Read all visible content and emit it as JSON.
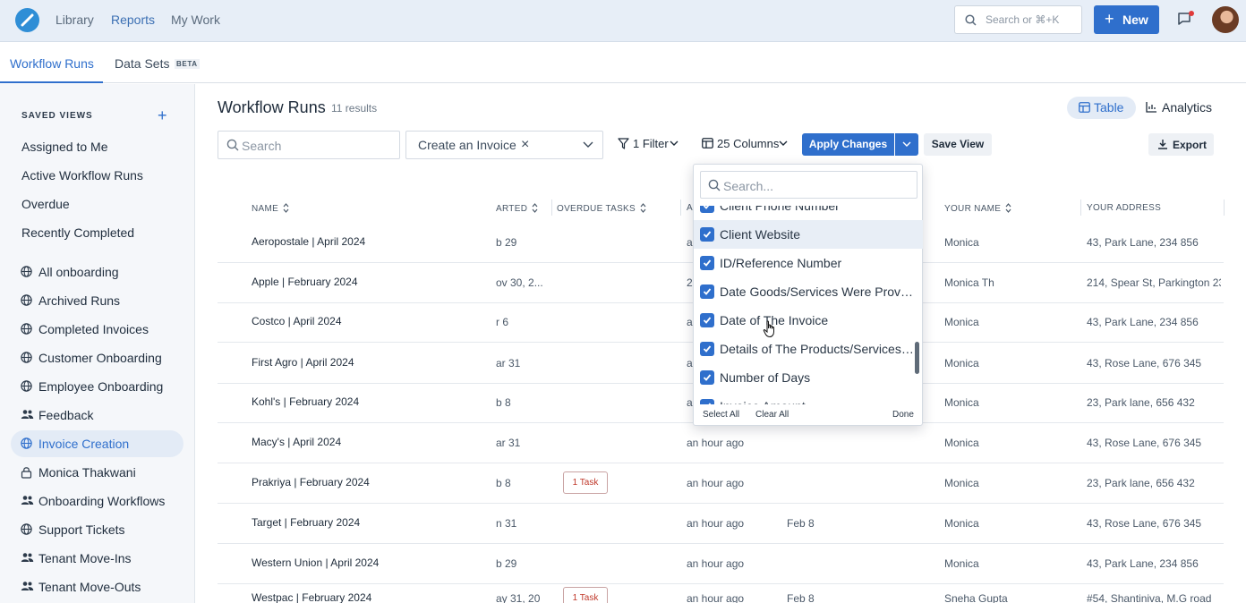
{
  "topbar": {
    "nav": [
      "Library",
      "Reports",
      "My Work"
    ],
    "active_nav": "Reports",
    "search_placeholder": "Search or ⌘+K",
    "new_label": "New",
    "brand_color": "#2f6fcc"
  },
  "subtabs": {
    "workflow_runs": "Workflow Runs",
    "data_sets": "Data Sets",
    "beta": "BETA"
  },
  "sidebar": {
    "saved_views_title": "SAVED VIEWS",
    "plain_items": [
      "Assigned to Me",
      "Active Workflow Runs",
      "Overdue",
      "Recently Completed"
    ],
    "items": [
      {
        "label": "All onboarding",
        "icon": "globe-icon"
      },
      {
        "label": "Archived Runs",
        "icon": "globe-icon"
      },
      {
        "label": "Completed Invoices",
        "icon": "globe-icon"
      },
      {
        "label": "Customer Onboarding",
        "icon": "globe-icon"
      },
      {
        "label": "Employee Onboarding",
        "icon": "globe-icon"
      },
      {
        "label": "Feedback",
        "icon": "users-icon"
      },
      {
        "label": "Invoice Creation",
        "icon": "globe-icon"
      },
      {
        "label": "Monica Thakwani",
        "icon": "lock-icon"
      },
      {
        "label": "Onboarding Workflows",
        "icon": "users-icon"
      },
      {
        "label": "Support Tickets",
        "icon": "globe-icon"
      },
      {
        "label": "Tenant Move-Ins",
        "icon": "users-icon"
      },
      {
        "label": "Tenant Move-Outs",
        "icon": "users-icon"
      }
    ],
    "active_item": "Invoice Creation"
  },
  "main": {
    "title": "Workflow Runs",
    "results": "11 results",
    "view_table": "Table",
    "view_analytics": "Analytics",
    "search_placeholder": "Search",
    "workflow_chip": "Create an Invoice",
    "filter_label": "1 Filter",
    "columns_label": "25 Columns",
    "apply_label": "Apply Changes",
    "save_view_label": "Save View",
    "export_label": "Export"
  },
  "table": {
    "headers": {
      "name": "NAME",
      "started": "ARTED",
      "overdue": "OVERDUE TASKS",
      "fourth": "A",
      "your_name": "YOUR NAME",
      "your_address": "YOUR ADDRESS"
    },
    "rows": [
      {
        "name": "Aeropostale | April 2024",
        "started": "b 29",
        "overdue": "",
        "col4": "a",
        "col5": "",
        "your_name": "Monica",
        "your_address": "43, Park Lane, 234 856"
      },
      {
        "name": "Apple | February 2024",
        "started": "ov 30, 2...",
        "overdue": "",
        "col4": "2",
        "col5": "",
        "your_name": "Monica Th",
        "your_address": "214, Spear St, Parkington 23"
      },
      {
        "name": "Costco | April 2024",
        "started": "r 6",
        "overdue": "",
        "col4": "a",
        "col5": "",
        "your_name": "Monica",
        "your_address": "43, Park Lane, 234 856"
      },
      {
        "name": "First Agro | April 2024",
        "started": "ar 31",
        "overdue": "",
        "col4": "a",
        "col5": "",
        "your_name": "Monica",
        "your_address": "43, Rose Lane, 676 345"
      },
      {
        "name": "Kohl's | February 2024",
        "started": "b 8",
        "overdue": "",
        "col4": "a",
        "col5": "",
        "your_name": "Monica",
        "your_address": "23, Park lane, 656 432"
      },
      {
        "name": "Macy's | April 2024",
        "started": "ar 31",
        "overdue": "",
        "col4": "an hour ago",
        "col5": "",
        "your_name": "Monica",
        "your_address": "43, Rose Lane, 676 345"
      },
      {
        "name": "Prakriya | February 2024",
        "started": "b 8",
        "overdue": "1 Task",
        "col4": "an hour ago",
        "col5": "",
        "your_name": "Monica",
        "your_address": "23, Park lane, 656 432"
      },
      {
        "name": "Target | February 2024",
        "started": "n 31",
        "overdue": "",
        "col4": "an hour ago",
        "col5": "Feb 8",
        "your_name": "Monica",
        "your_address": "43, Rose Lane, 676 345"
      },
      {
        "name": "Western Union | April 2024",
        "started": "b 29",
        "overdue": "",
        "col4": "an hour ago",
        "col5": "",
        "your_name": "Monica",
        "your_address": "43, Park Lane, 234 856"
      },
      {
        "name": "Westpac | February 2024",
        "started": "ay 31, 20",
        "overdue": "1 Task",
        "col4": "an hour ago",
        "col5": "Feb 8",
        "your_name": "Sneha Gupta",
        "your_address": "#54, Shantiniva, M.G road"
      }
    ]
  },
  "columns_dropdown": {
    "search_placeholder": "Search...",
    "items": [
      {
        "label": "Client Phone Number",
        "checked": true
      },
      {
        "label": "Client Website",
        "checked": true
      },
      {
        "label": "ID/Reference Number",
        "checked": true
      },
      {
        "label": "Date Goods/Services Were Provid...",
        "checked": true
      },
      {
        "label": "Date of The Invoice",
        "checked": true
      },
      {
        "label": "Details of The Products/Services P...",
        "checked": true
      },
      {
        "label": "Number of Days",
        "checked": true
      },
      {
        "label": "Invoice Amount",
        "checked": true
      }
    ],
    "hovered": "Client Website",
    "select_all": "Select All",
    "clear_all": "Clear All",
    "done": "Done"
  },
  "colors": {
    "accent": "#2f6fcc",
    "sidebar_bg": "#f5f7fa",
    "topbar_bg": "#e7eef7",
    "overdue_text": "#c0392b"
  }
}
